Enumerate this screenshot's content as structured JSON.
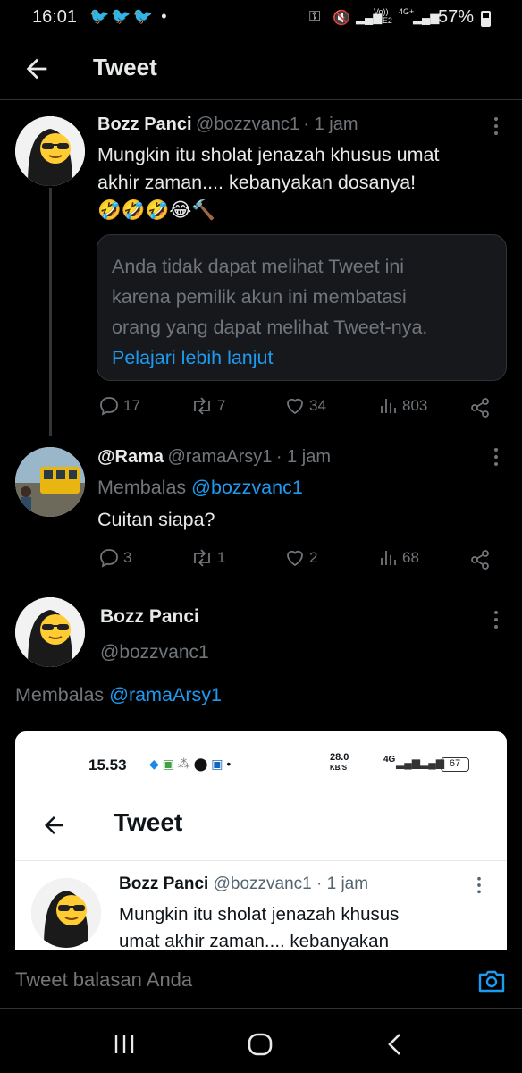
{
  "status_bar": {
    "time": "16:01",
    "network": "Vo)) LTE2",
    "net_type": "4G+",
    "battery": "57%"
  },
  "header": {
    "title": "Tweet"
  },
  "tweet1": {
    "name": "Bozz Panci",
    "handle": "@bozzvanc1",
    "time": "· 1 jam",
    "text_line1": "Mungkin itu sholat jenazah khusus umat",
    "text_line2": "akhir zaman.... kebanyakan dosanya!",
    "emojis": "🤣🤣🤣😂🔨",
    "quote_line1": "Anda tidak dapat melihat Tweet ini",
    "quote_line2": "karena pemilik akun ini membatasi",
    "quote_line3": "orang yang dapat melihat Tweet-nya.",
    "quote_link": "Pelajari lebih lanjut",
    "replies": "17",
    "retweets": "7",
    "likes": "34",
    "views": "803"
  },
  "tweet2": {
    "name": "@Rama",
    "handle": "@ramaArsy1",
    "time": "· 1 jam",
    "reply_prefix": "Membalas",
    "reply_to": "@bozzvanc1",
    "text": "Cuitan siapa?",
    "replies": "3",
    "retweets": "1",
    "likes": "2",
    "views": "68"
  },
  "tweet3": {
    "name": "Bozz Panci",
    "handle": "@bozzvanc1",
    "reply_prefix": "Membalas",
    "reply_to": "@ramaArsy1"
  },
  "embedded_screenshot": {
    "time": "15.53",
    "speed": "28.0",
    "speed_unit": "KB/S",
    "net": "4G",
    "battery": "67",
    "title": "Tweet",
    "name": "Bozz Panci",
    "handle": "@bozzvanc1",
    "time_ago": "· 1 jam",
    "text_line1": "Mungkin itu sholat jenazah khusus",
    "text_line2": "umat akhir zaman.... kebanyakan"
  },
  "reply_bar": {
    "placeholder": "Tweet balasan Anda"
  },
  "colors": {
    "accent": "#1d9bf0",
    "background": "#000000",
    "muted": "#71767b"
  }
}
